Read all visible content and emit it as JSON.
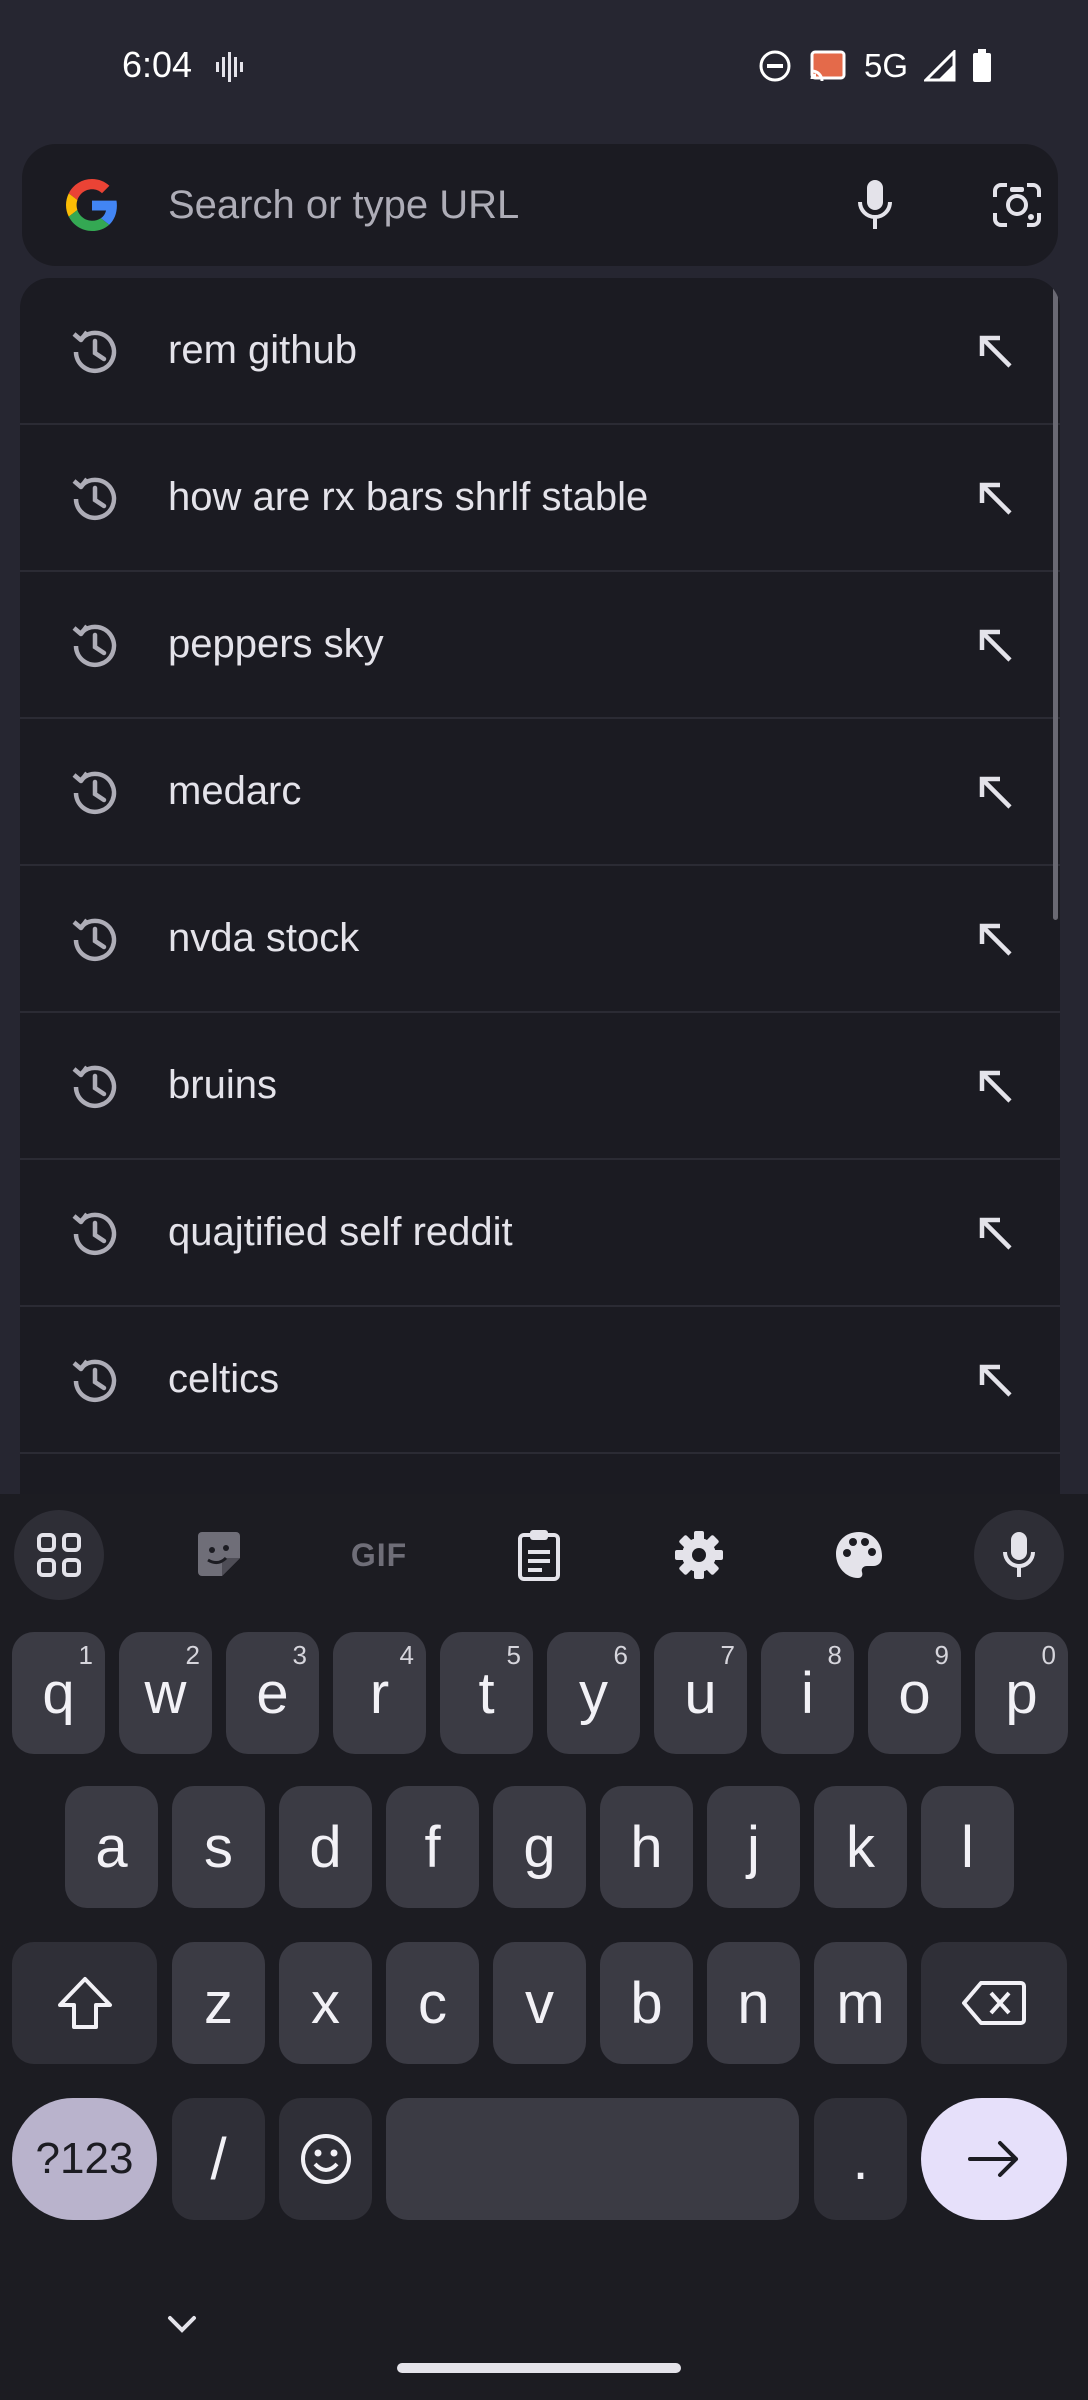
{
  "status_bar": {
    "time": "6:04",
    "network": "5G"
  },
  "omnibox": {
    "placeholder": "Search or type URL",
    "value": ""
  },
  "suggestions": [
    {
      "text": "rem github"
    },
    {
      "text": "how are rx bars shrlf stable"
    },
    {
      "text": "peppers sky"
    },
    {
      "text": "medarc"
    },
    {
      "text": "nvda stock"
    },
    {
      "text": "bruins"
    },
    {
      "text": "quajtified self reddit"
    },
    {
      "text": "celtics"
    }
  ],
  "keyboard": {
    "toolbar": {
      "gif_label": "GIF",
      "icons": [
        "apps-grid-icon",
        "sticker-icon",
        "gif-icon",
        "clipboard-icon",
        "settings-gear-icon",
        "palette-icon",
        "microphone-icon"
      ]
    },
    "row1": [
      {
        "key": "q",
        "hint": "1"
      },
      {
        "key": "w",
        "hint": "2"
      },
      {
        "key": "e",
        "hint": "3"
      },
      {
        "key": "r",
        "hint": "4"
      },
      {
        "key": "t",
        "hint": "5"
      },
      {
        "key": "y",
        "hint": "6"
      },
      {
        "key": "u",
        "hint": "7"
      },
      {
        "key": "i",
        "hint": "8"
      },
      {
        "key": "o",
        "hint": "9"
      },
      {
        "key": "p",
        "hint": "0"
      }
    ],
    "row2": [
      "a",
      "s",
      "d",
      "f",
      "g",
      "h",
      "j",
      "k",
      "l"
    ],
    "row3": [
      "z",
      "x",
      "c",
      "v",
      "b",
      "n",
      "m"
    ],
    "symbols_label": "?123",
    "slash_label": "/",
    "period_label": ".",
    "accent_color": "#e6e0fa"
  },
  "colors": {
    "background": "#262631",
    "surface": "#1b1b22",
    "key": "#3b3b44"
  }
}
